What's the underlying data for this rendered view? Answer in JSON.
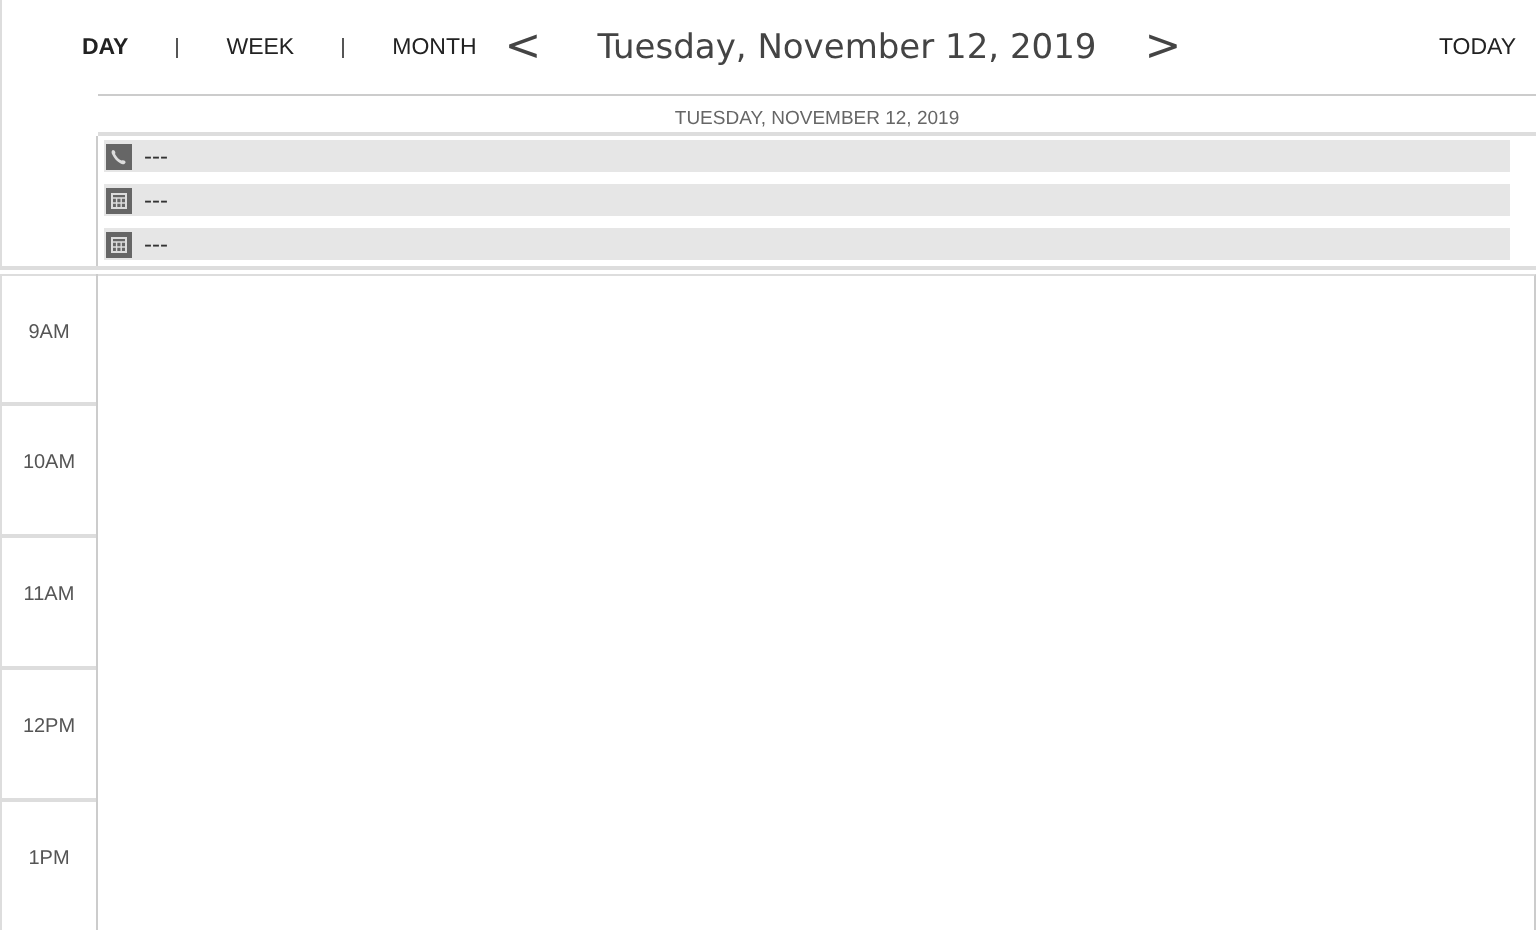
{
  "views": [
    {
      "label": "DAY",
      "selected": true
    },
    {
      "label": "WEEK",
      "selected": false
    },
    {
      "label": "MONTH",
      "selected": false
    }
  ],
  "nav": {
    "previous": "<",
    "title": "Tuesday, November 12, 2019",
    "next": ">",
    "today": "TODAY"
  },
  "day_header": "TUESDAY, NOVEMBER 12, 2019",
  "all_day_events": [
    {
      "kind": "phone",
      "text": "---"
    },
    {
      "kind": "appointment",
      "text": "---"
    },
    {
      "kind": "appointment",
      "text": "---"
    }
  ],
  "hours": [
    "9AM",
    "10AM",
    "11AM",
    "12PM",
    "1PM"
  ]
}
